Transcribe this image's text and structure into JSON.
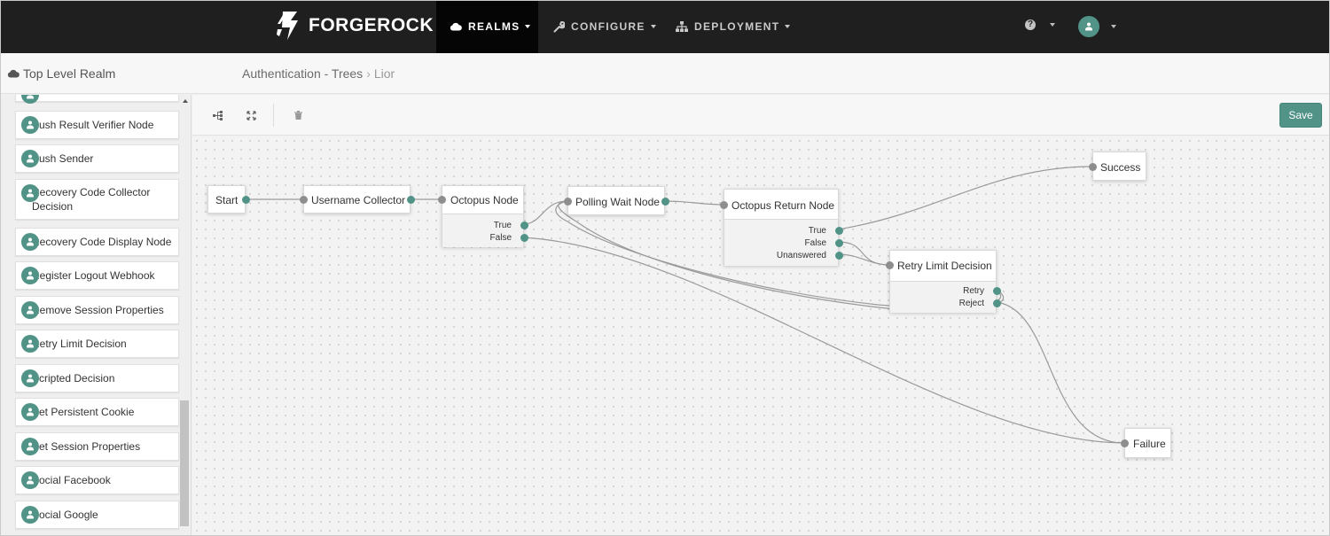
{
  "brand": {
    "name": "FORGEROCK",
    "accent": "#519387"
  },
  "nav": {
    "items": [
      {
        "label": "REALMS",
        "icon": "cloud-icon"
      },
      {
        "label": "CONFIGURE",
        "icon": "wrench-icon"
      },
      {
        "label": "DEPLOYMENT",
        "icon": "sitemap-icon"
      }
    ],
    "help_icon": "question-circle-icon",
    "user_icon": "user-avatar-icon"
  },
  "subheader": {
    "realm": "Top Level Realm",
    "breadcrumb": {
      "parent": "Authentication - Trees",
      "separator": "›",
      "current": "Lior"
    }
  },
  "sidebar": {
    "items": [
      "Push Result Verifier Node",
      "Push Sender",
      "Recovery Code Collector Decision",
      "Recovery Code Display Node",
      "Register Logout Webhook",
      "Remove Session Properties",
      "Retry Limit Decision",
      "Scripted Decision",
      "Set Persistent Cookie",
      "Set Session Properties",
      "Social Facebook",
      "Social Google"
    ],
    "item_icon": "user-node-icon"
  },
  "toolbar": {
    "tools": [
      "tree-layout-icon",
      "fit-screen-icon",
      "trash-icon"
    ],
    "save_label": "Save"
  },
  "tree": {
    "nodes": {
      "start": {
        "title": "Start",
        "outcomes": []
      },
      "username": {
        "title": "Username Collector",
        "outcomes": []
      },
      "octopus": {
        "title": "Octopus Node",
        "outcomes": [
          "True",
          "False"
        ]
      },
      "polling": {
        "title": "Polling Wait Node",
        "outcomes": []
      },
      "octopus_return": {
        "title": "Octopus Return Node",
        "outcomes": [
          "True",
          "False",
          "Unanswered"
        ]
      },
      "retry": {
        "title": "Retry Limit Decision",
        "outcomes": [
          "Retry",
          "Reject"
        ]
      },
      "success": {
        "title": "Success",
        "outcomes": []
      },
      "failure": {
        "title": "Failure",
        "outcomes": []
      }
    },
    "connections": [
      {
        "from": "start",
        "outcome": "",
        "to": "username"
      },
      {
        "from": "username",
        "outcome": "",
        "to": "octopus"
      },
      {
        "from": "octopus",
        "outcome": "True",
        "to": "polling"
      },
      {
        "from": "octopus",
        "outcome": "False",
        "to": "failure"
      },
      {
        "from": "polling",
        "outcome": "",
        "to": "octopus_return"
      },
      {
        "from": "octopus_return",
        "outcome": "True",
        "to": "success"
      },
      {
        "from": "octopus_return",
        "outcome": "False",
        "to": "retry"
      },
      {
        "from": "octopus_return",
        "outcome": "Unanswered",
        "to": "retry"
      },
      {
        "from": "retry",
        "outcome": "Retry",
        "to": "polling"
      },
      {
        "from": "retry",
        "outcome": "Reject",
        "to": "failure"
      }
    ]
  }
}
